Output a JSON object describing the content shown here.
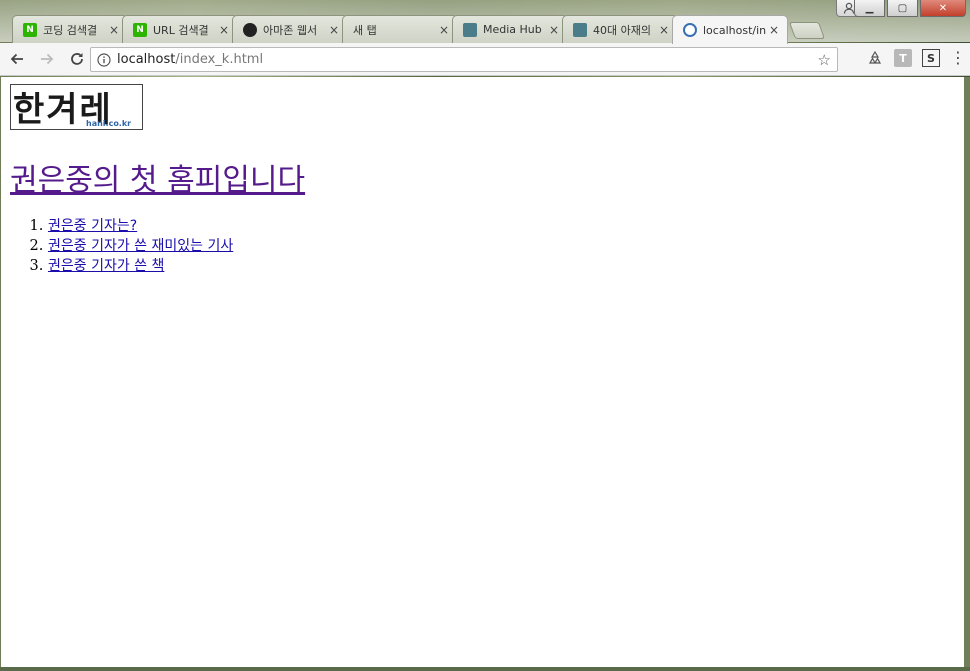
{
  "window": {
    "controls": {
      "minimize": "▁",
      "maximize": "▢",
      "close": "✕"
    }
  },
  "tabs": [
    {
      "label": "코딩 검색결",
      "icon": "naver-n-icon",
      "favicon_text": "N",
      "active": false
    },
    {
      "label": "URL 검색결",
      "icon": "naver-n-icon",
      "favicon_text": "N",
      "active": false
    },
    {
      "label": "아마존 웹서",
      "icon": "dark-circle-icon",
      "favicon_text": "",
      "active": false
    },
    {
      "label": "새 탭",
      "icon": "",
      "favicon_text": "",
      "active": false
    },
    {
      "label": "Media Hub",
      "icon": "media-hub-icon",
      "favicon_text": "",
      "active": false
    },
    {
      "label": "40대 아재의",
      "icon": "media-hub-icon",
      "favicon_text": "",
      "active": false
    },
    {
      "label": "localhost/in",
      "icon": "localhost-icon",
      "favicon_text": "",
      "active": true
    }
  ],
  "tab_close_glyph": "×",
  "toolbar": {
    "url_host": "localhost",
    "url_path": "/index_k.html",
    "star_glyph": "☆"
  },
  "extensions": {
    "t_label": "T",
    "s_label": "S"
  },
  "page": {
    "logo_text": "한겨레",
    "logo_sub": "hani.co.kr",
    "headline": "권은중의 첫 홈피입니다",
    "links": [
      "권은중 기자는?",
      "권은중 기자가 쓴 재미있는 기사",
      "권은중 기자가 쓴 책"
    ]
  },
  "colors": {
    "visited_link": "#551a8b",
    "link": "#1a0dab",
    "logo_sub": "#2c66a8"
  }
}
